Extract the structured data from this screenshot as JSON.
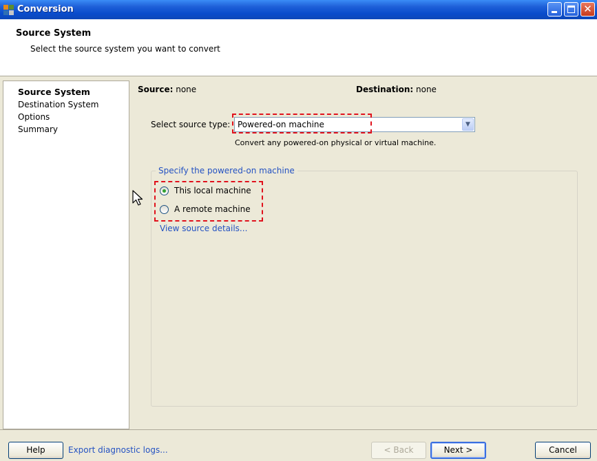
{
  "window": {
    "title": "Conversion",
    "controls": [
      "minimize-icon",
      "maximize-icon",
      "close-icon"
    ]
  },
  "header": {
    "title": "Source System",
    "subtitle": "Select the source system you want to convert"
  },
  "sidebar": {
    "items": [
      {
        "label": "Source System",
        "active": true
      },
      {
        "label": "Destination System",
        "active": false
      },
      {
        "label": "Options",
        "active": false
      },
      {
        "label": "Summary",
        "active": false
      }
    ]
  },
  "main": {
    "source_label": "Source:",
    "source_value": "none",
    "destination_label": "Destination:",
    "destination_value": "none",
    "select_label": "Select source type:",
    "select_value": "Powered-on machine",
    "select_hint": "Convert any powered-on physical or virtual machine.",
    "group_title": "Specify the powered-on machine",
    "radios": [
      {
        "label": "This local machine",
        "checked": true
      },
      {
        "label": "A remote machine",
        "checked": false
      }
    ],
    "details_link": "View source details..."
  },
  "footer": {
    "help": "Help",
    "export_link": "Export diagnostic logs...",
    "back": "< Back",
    "next": "Next >",
    "cancel": "Cancel"
  },
  "colors": {
    "highlight_box": "#e0101b",
    "link": "#2452c2",
    "radio_dot": "#31a231"
  }
}
